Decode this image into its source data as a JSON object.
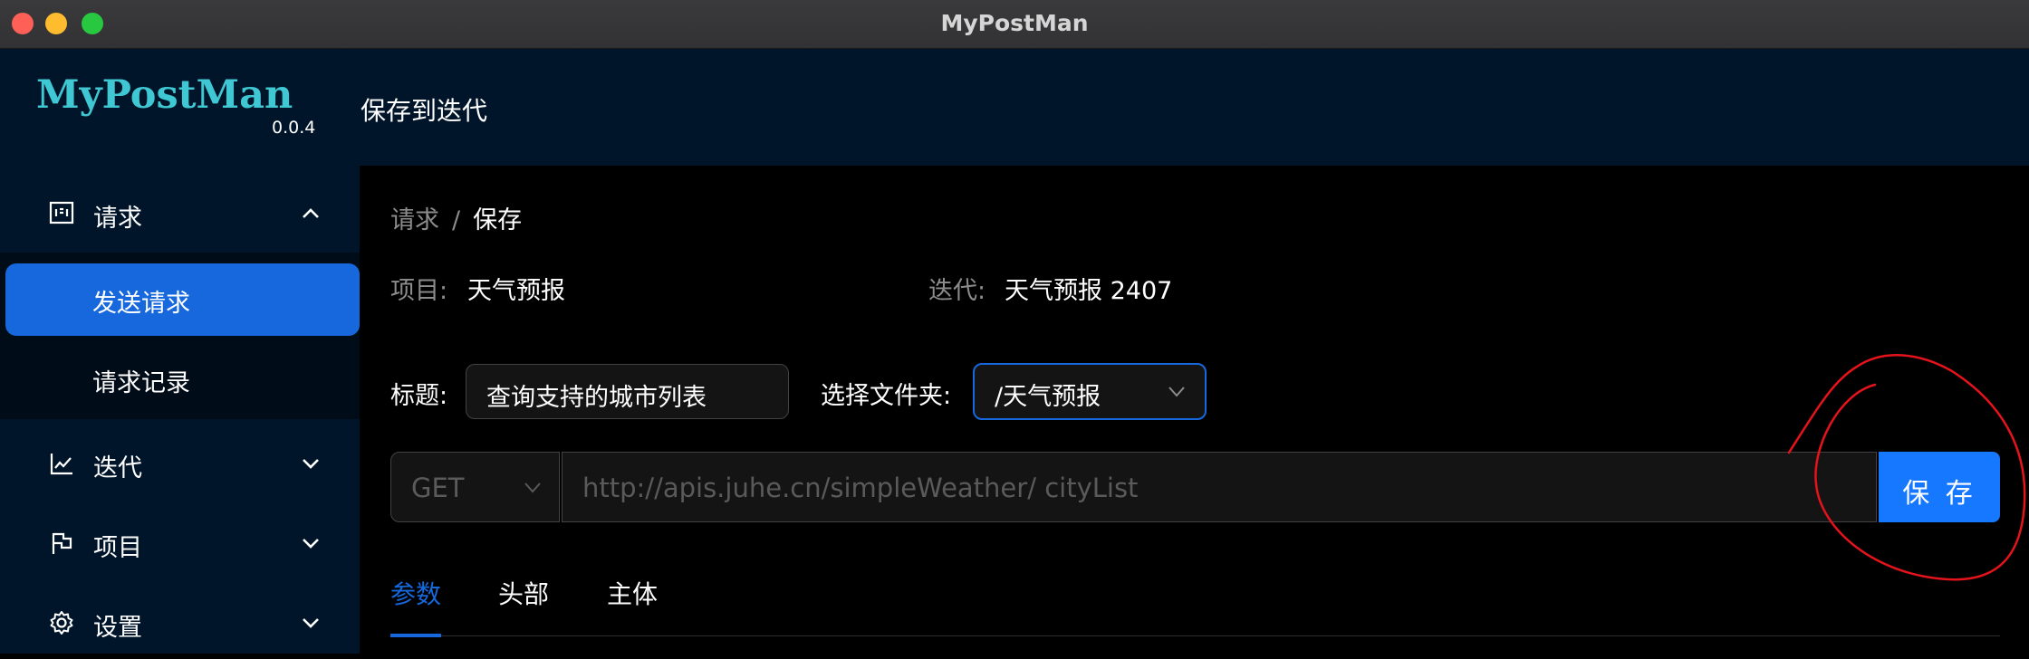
{
  "window": {
    "title": "MyPostMan"
  },
  "brand": {
    "logo": "MyPostMan",
    "version": "0.0.4"
  },
  "header": {
    "title": "保存到迭代"
  },
  "sidebar": {
    "items": [
      {
        "label": "请求",
        "icon": "request-icon",
        "expanded": true,
        "children": [
          {
            "label": "发送请求",
            "active": true
          },
          {
            "label": "请求记录",
            "active": false
          }
        ]
      },
      {
        "label": "迭代",
        "icon": "chart-icon",
        "expanded": false
      },
      {
        "label": "项目",
        "icon": "flag-icon",
        "expanded": false
      },
      {
        "label": "设置",
        "icon": "gear-icon",
        "expanded": false
      }
    ]
  },
  "breadcrumb": {
    "parent": "请求",
    "separator": "/",
    "current": "保存"
  },
  "info": {
    "project_label": "项目:",
    "project_value": "天气预报",
    "iteration_label": "迭代:",
    "iteration_value": "天气预报 2407"
  },
  "form": {
    "title_label": "标题:",
    "title_value": "查询支持的城市列表",
    "folder_label": "选择文件夹:",
    "folder_value": "/天气预报",
    "method": "GET",
    "url": "http://apis.juhe.cn/simpleWeather/ cityList",
    "save_label": "保 存"
  },
  "tabs": [
    {
      "label": "参数",
      "active": true
    },
    {
      "label": "头部",
      "active": false
    },
    {
      "label": "主体",
      "active": false
    }
  ],
  "colors": {
    "accent": "#1668dc",
    "sidebar_bg": "#001529",
    "logo": "#3fc7d4",
    "save_button": "#1677ff",
    "annotation": "#e5131b"
  }
}
